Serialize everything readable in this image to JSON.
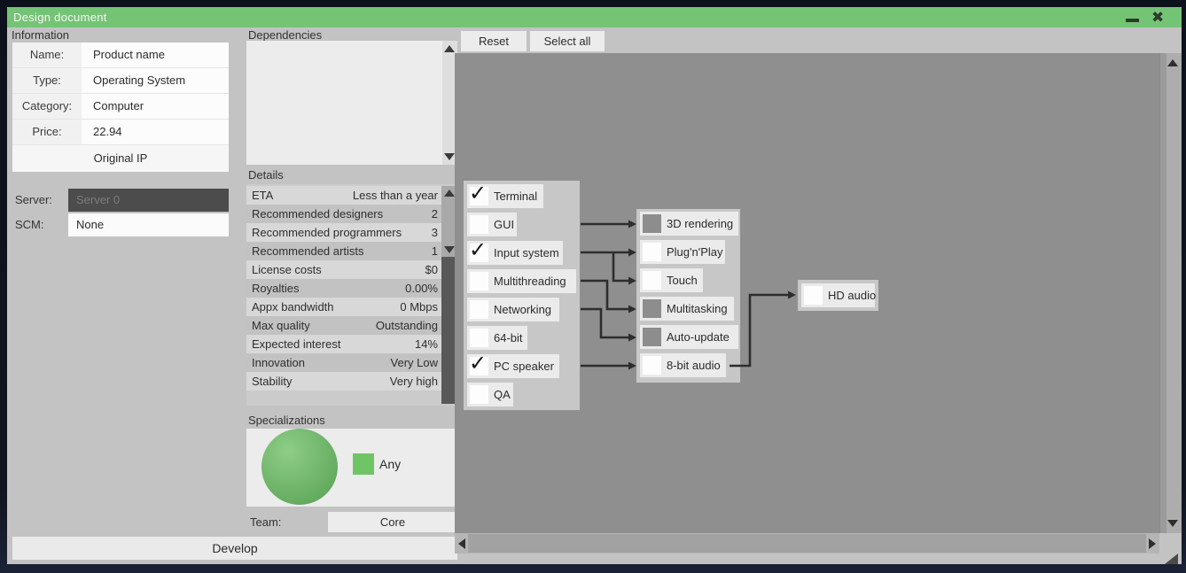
{
  "window": {
    "title": "Design document"
  },
  "colors": {
    "titlebar_green": "#74c476",
    "pie_green": "#6db868",
    "legend_green": "#6fc566",
    "locked_checkbox_gray": "#8d8d8d",
    "server_field_dark": "#4c4c4c"
  },
  "toolbar": {
    "reset": "Reset",
    "select_all": "Select all"
  },
  "information": {
    "header": "Information",
    "fields": [
      {
        "label": "Name:",
        "value": "Product name"
      },
      {
        "label": "Type:",
        "value": "Operating System"
      },
      {
        "label": "Category:",
        "value": "Computer"
      },
      {
        "label": "Price:",
        "value": "22.94"
      }
    ],
    "original_ip": "Original IP",
    "server": {
      "label": "Server:",
      "value": "Server 0"
    },
    "scm": {
      "label": "SCM:",
      "value": "None"
    }
  },
  "dependencies": {
    "header": "Dependencies"
  },
  "details": {
    "header": "Details",
    "rows": [
      {
        "label": "ETA",
        "value": "Less than a year"
      },
      {
        "label": "Recommended designers",
        "value": "2"
      },
      {
        "label": "Recommended programmers",
        "value": "3"
      },
      {
        "label": "Recommended artists",
        "value": "1"
      },
      {
        "label": "License costs",
        "value": "$0"
      },
      {
        "label": "Royalties",
        "value": "0.00%"
      },
      {
        "label": "Appx bandwidth",
        "value": "0 Mbps"
      },
      {
        "label": "Max quality",
        "value": "Outstanding"
      },
      {
        "label": "Expected interest",
        "value": "14%"
      },
      {
        "label": "Innovation",
        "value": "Very Low"
      },
      {
        "label": "Stability",
        "value": "Very high"
      }
    ]
  },
  "specializations": {
    "header": "Specializations",
    "legend_label": "Any"
  },
  "team": {
    "label": "Team:",
    "value": "Core"
  },
  "develop": {
    "label": "Develop"
  },
  "feature_tree": {
    "column1": [
      {
        "label": "Terminal",
        "checked": true
      },
      {
        "label": "GUI",
        "checked": false
      },
      {
        "label": "Input system",
        "checked": true
      },
      {
        "label": "Multithreading",
        "checked": false
      },
      {
        "label": "Networking",
        "checked": false
      },
      {
        "label": "64-bit",
        "checked": false
      },
      {
        "label": "PC speaker",
        "checked": true
      },
      {
        "label": "QA",
        "checked": false
      }
    ],
    "column2": [
      {
        "label": "3D rendering",
        "locked": true
      },
      {
        "label": "Plug'n'Play",
        "locked": false
      },
      {
        "label": "Touch",
        "locked": false
      },
      {
        "label": "Multitasking",
        "locked": true
      },
      {
        "label": "Auto-update",
        "locked": true
      },
      {
        "label": "8-bit audio",
        "locked": false
      }
    ],
    "column3": [
      {
        "label": "HD audio",
        "locked": false
      }
    ],
    "connections": [
      "GUI -> 3D rendering",
      "Input system -> Plug'n'Play",
      "Input system -> Touch",
      "Multithreading -> Multitasking",
      "Networking -> Auto-update",
      "PC speaker -> 8-bit audio",
      "8-bit audio -> HD audio"
    ]
  }
}
